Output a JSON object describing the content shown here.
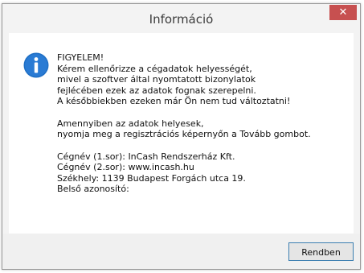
{
  "window": {
    "title": "Információ",
    "close_label": "✕"
  },
  "message": {
    "icon": "info-icon",
    "paragraph1": [
      "FIGYELEM!",
      "Kérem ellenőrizze a cégadatok helyességét,",
      "mivel a szoftver által nyomtatott bizonylatok",
      "fejlécében ezek az adatok fognak szerepelni.",
      "A későbbiekben ezeken már Ön nem tud változtatni!"
    ],
    "paragraph2": [
      "Amennyiben az adatok helyesek,",
      "nyomja meg a regisztrációs képernyőn a Tovább gombot."
    ],
    "paragraph3": [
      "Cégnév (1.sor): InCash Rendszerház Kft.",
      "Cégnév (2.sor): www.incash.hu",
      "Székhely: 1139 Budapest Forgách utca 19.",
      "Belső azonosító:"
    ]
  },
  "footer": {
    "ok_label": "Rendben"
  },
  "colors": {
    "accent": "#1f6fc5",
    "close": "#c75050"
  }
}
